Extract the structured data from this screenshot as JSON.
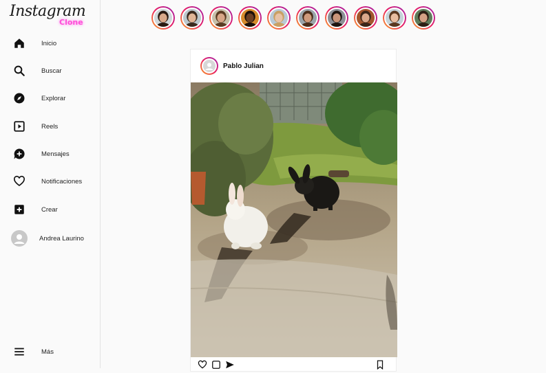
{
  "logo": {
    "main": "Instagram",
    "sub": "Clone"
  },
  "nav": [
    {
      "label": "Inicio",
      "icon": "home-icon"
    },
    {
      "label": "Buscar",
      "icon": "search-icon"
    },
    {
      "label": "Explorar",
      "icon": "compass-icon"
    },
    {
      "label": "Reels",
      "icon": "reels-icon"
    },
    {
      "label": "Mensajes",
      "icon": "message-icon"
    },
    {
      "label": "Notificaciones",
      "icon": "heart-icon"
    },
    {
      "label": "Crear",
      "icon": "plus-square-icon"
    },
    {
      "label": "Andrea Laurino",
      "icon": "user-avatar-icon"
    }
  ],
  "more": {
    "label": "Más",
    "icon": "menu-icon"
  },
  "stories": [
    {
      "skin": "#d9a98a",
      "hair": "#2a1a12",
      "bg": "#cfd6d8"
    },
    {
      "skin": "#e0b596",
      "hair": "#3b2a1e",
      "bg": "#bcc7cc"
    },
    {
      "skin": "#d8a687",
      "hair": "#5b3b22",
      "bg": "#c7bfa8"
    },
    {
      "skin": "#6b3f22",
      "hair": "#1a0f08",
      "bg": "#d68b2c"
    },
    {
      "skin": "#e8c2a6",
      "hair": "#c9a063",
      "bg": "#b9c9d6"
    },
    {
      "skin": "#cf9a7b",
      "hair": "#4a2d1a",
      "bg": "#9aa4aa"
    },
    {
      "skin": "#c9957a",
      "hair": "#1d1410",
      "bg": "#8c8f96"
    },
    {
      "skin": "#d9a88b",
      "hair": "#3a2518",
      "bg": "#a3562e"
    },
    {
      "skin": "#e7bda0",
      "hair": "#5a3820",
      "bg": "#c4d3d9"
    },
    {
      "skin": "#d5a184",
      "hair": "#2f1f14",
      "bg": "#5f7b5a"
    }
  ],
  "post": {
    "user": "Pablo Julian",
    "actions": [
      "heart-icon",
      "comment-icon",
      "share-icon",
      "bookmark-icon"
    ]
  },
  "colors": {
    "accent": "#ff4fd8",
    "ring_start": "#f9a825",
    "ring_mid": "#e91e63",
    "ring_end": "#9c27b0"
  }
}
